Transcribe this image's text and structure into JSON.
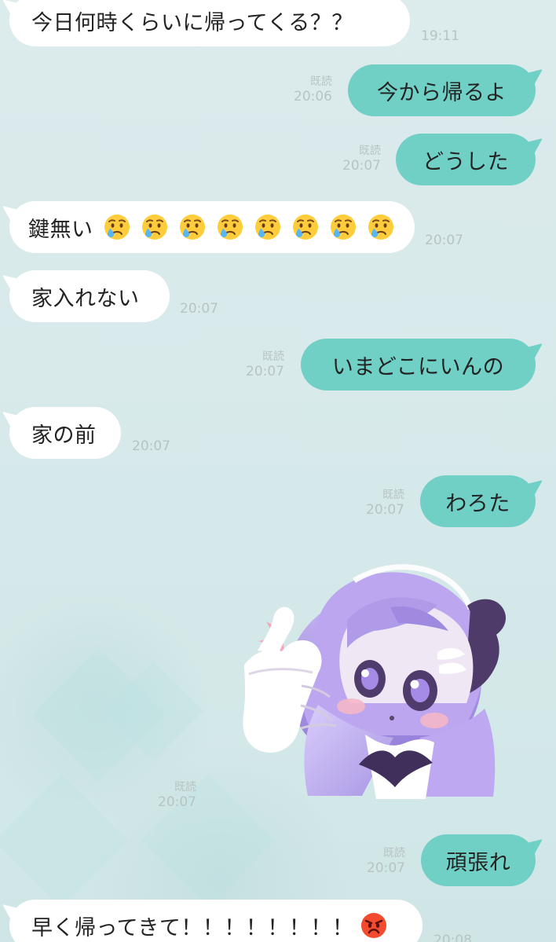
{
  "messages": [
    {
      "id": "m1",
      "side": "left",
      "text": "今日何時くらいに帰ってくる？？",
      "time": "19:11"
    },
    {
      "id": "m2",
      "side": "right",
      "text": "今から帰るよ",
      "read": "既読",
      "time": "20:06"
    },
    {
      "id": "m3",
      "side": "right",
      "text": "どうした",
      "read": "既読",
      "time": "20:07"
    },
    {
      "id": "m4",
      "side": "left",
      "text": "鍵無い",
      "emoji_name": "crying-face-icon",
      "emoji_count": 8,
      "time": "20:07"
    },
    {
      "id": "m5",
      "side": "left",
      "text": "家入れない",
      "time": "20:07"
    },
    {
      "id": "m6",
      "side": "right",
      "text": "いまどこにいんの",
      "read": "既読",
      "time": "20:07"
    },
    {
      "id": "m7",
      "side": "left",
      "text": "家の前",
      "time": "20:07"
    },
    {
      "id": "m8",
      "side": "right",
      "text": "わろた",
      "read": "既読",
      "time": "20:07"
    },
    {
      "id": "m9",
      "side": "right",
      "type": "sticker",
      "sticker_icon": "purple-hair-girl-pointing-sticker",
      "read": "既読",
      "time": "20:07"
    },
    {
      "id": "m10",
      "side": "right",
      "text": "頑張れ",
      "read": "既読",
      "time": "20:07"
    },
    {
      "id": "m11",
      "side": "left",
      "text": "早く帰ってきて！！！！！！！！",
      "emoji_name": "angry-face-icon",
      "time": "20:08"
    }
  ],
  "colors": {
    "background": "#d9ecec",
    "sent_bubble": "#71d0c5",
    "received_bubble": "#ffffff",
    "timestamp": "#b8c4c4"
  }
}
